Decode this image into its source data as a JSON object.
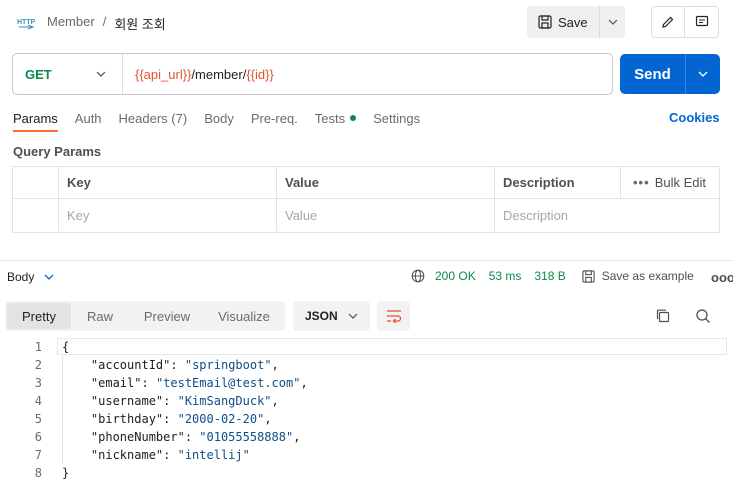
{
  "header": {
    "breadcrumb_parent": "Member",
    "breadcrumb_separator": "/",
    "breadcrumb_current": "회원 조회",
    "save_label": "Save"
  },
  "request": {
    "method": "GET",
    "url_parts": {
      "var1": "{{api_url}}",
      "path": "/member/",
      "var2": "{{id}}"
    },
    "send_label": "Send"
  },
  "tabs": {
    "params": "Params",
    "auth": "Auth",
    "headers": "Headers (7)",
    "body": "Body",
    "prereq": "Pre-req.",
    "tests": "Tests",
    "settings": "Settings",
    "cookies": "Cookies"
  },
  "query_params": {
    "title": "Query Params",
    "headers": {
      "key": "Key",
      "value": "Value",
      "description": "Description",
      "bulk_edit": "Bulk Edit"
    },
    "placeholders": {
      "key": "Key",
      "value": "Value",
      "description": "Description"
    }
  },
  "response": {
    "body_label": "Body",
    "status": "200 OK",
    "time": "53 ms",
    "size": "318 B",
    "save_example": "Save as example",
    "views": {
      "pretty": "Pretty",
      "raw": "Raw",
      "preview": "Preview",
      "visualize": "Visualize"
    },
    "format": "JSON",
    "lines": [
      {
        "num": "1",
        "text": "{"
      },
      {
        "num": "2",
        "key": "\"accountId\"",
        "value": "\"springboot\""
      },
      {
        "num": "3",
        "key": "\"email\"",
        "value": "\"testEmail@test.com\""
      },
      {
        "num": "4",
        "key": "\"username\"",
        "value": "\"KimSangDuck\""
      },
      {
        "num": "5",
        "key": "\"birthday\"",
        "value": "\"2000-02-20\""
      },
      {
        "num": "6",
        "key": "\"phoneNumber\"",
        "value": "\"01055558888\""
      },
      {
        "num": "7",
        "key": "\"nickname\"",
        "value": "\"intellij\""
      },
      {
        "num": "8",
        "text": "}"
      }
    ]
  },
  "colors": {
    "accent": "#ff6c37",
    "send": "#0265d2",
    "method_get": "#0b8a4a",
    "variable": "#e0562e",
    "json_string": "#0e4f8a"
  }
}
